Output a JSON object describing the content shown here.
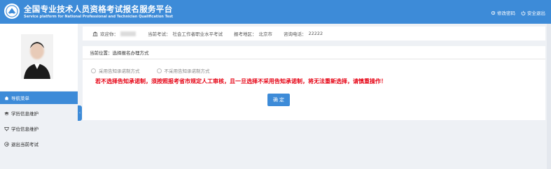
{
  "header": {
    "title": "全国专业技术人员资格考试报名服务平台",
    "subtitle": "Service platform for National Professional and Technician Qualification Test",
    "links": [
      {
        "label": "修改密码",
        "icon": "gear-icon"
      },
      {
        "label": "安全退出",
        "icon": "power-icon"
      }
    ]
  },
  "info": {
    "welcome_label": "欢迎你：",
    "exam_label": "当前考试：",
    "exam_value": "社会工作者职业水平考试",
    "area_label": "报考地区：",
    "area_value": "北京市",
    "phone_label": "咨询电话：",
    "phone_value": "22222"
  },
  "sidebar": {
    "nav_head": "导航菜单",
    "items": [
      {
        "label": "学历信息维护",
        "icon": "graduation-cap-icon"
      },
      {
        "label": "学位信息维护",
        "icon": "degree-icon"
      },
      {
        "label": "退出当前考试",
        "icon": "exit-icon"
      }
    ]
  },
  "panel": {
    "breadcrumb": "当前位置：选择报名办理方式",
    "options": [
      "采用告知承诺制方式",
      "不采用告知承诺制方式"
    ],
    "warning": "若不选择告知承诺制，须按照报考省市规定人工审核，且一旦选择不采用告知承诺制，将无法重新选择，请慎重操作！",
    "confirm_label": "确 定"
  },
  "colors": {
    "primary": "#3d8bd8",
    "warning": "#e60012"
  }
}
